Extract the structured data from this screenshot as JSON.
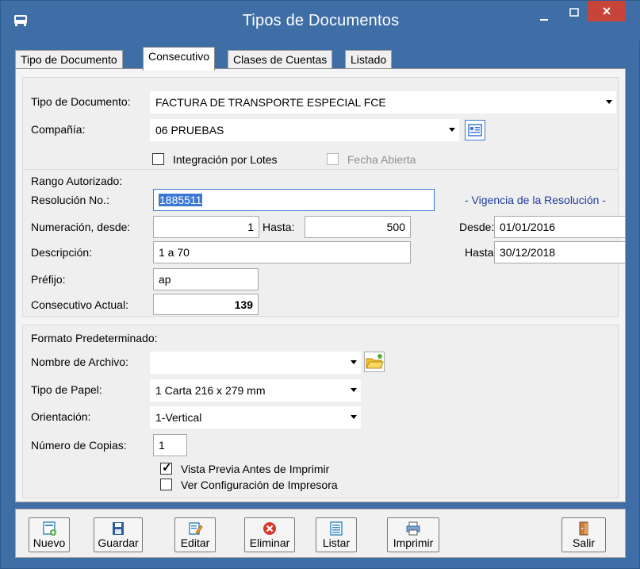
{
  "window": {
    "title": "Tipos de Documentos",
    "close_glyph": "×"
  },
  "tabs": [
    {
      "label": "Tipo de Documento"
    },
    {
      "label": "Consecutivo"
    },
    {
      "label": "Clases de Cuentas"
    },
    {
      "label": "Listado"
    }
  ],
  "form": {
    "tipo_documento": {
      "label": "Tipo de Documento:",
      "value": "FACTURA DE TRANSPORTE ESPECIAL FCE"
    },
    "compania": {
      "label": "Compañía:",
      "value": "06 PRUEBAS"
    },
    "integracion_lotes": {
      "label": "Integración por Lotes",
      "checked": false
    },
    "fecha_abierta": {
      "label": "Fecha Abierta",
      "checked": false,
      "enabled": false
    },
    "rango": {
      "title": "Rango Autorizado:",
      "resolucion_label": "Resolución No.:",
      "resolucion_value": "1885511",
      "vigencia_label": "- Vigencia de la Resolución -",
      "numeracion_label": "Numeración, desde:",
      "desde_num": "1",
      "hasta_label": "Hasta:",
      "hasta_num": "500",
      "fecha_desde_label": "Desde:",
      "fecha_desde": "01/01/2016",
      "fecha_hasta_label": "Hasta:",
      "fecha_hasta": "30/12/2018",
      "descripcion_label": "Descripción:",
      "descripcion": "1 a 70",
      "prefijo_label": "Préfijo:",
      "prefijo": "ap",
      "consecutivo_label": "Consecutivo Actual:",
      "consecutivo": "139"
    },
    "formato": {
      "title": "Formato Predeterminado:",
      "archivo_label": "Nombre de Archivo:",
      "archivo": "",
      "papel_label": "Tipo de Papel:",
      "papel": "1 Carta 216 x 279 mm",
      "orientacion_label": "Orientación:",
      "orientacion": "1-Vertical",
      "copias_label": "Número de Copias:",
      "copias": "1",
      "vista_previa": {
        "label": "Vista Previa Antes de Imprimir",
        "checked": true
      },
      "ver_config": {
        "label": "Ver Configuración de Impresora",
        "checked": false
      }
    }
  },
  "toolbar": {
    "nuevo": "Nuevo",
    "guardar": "Guardar",
    "editar": "Editar",
    "eliminar": "Eliminar",
    "listar": "Listar",
    "imprimir": "Imprimir",
    "salir": "Salir"
  },
  "colors": {
    "titlebar": "#3f6ea7",
    "close": "#c7443b",
    "selection": "#3b78d4"
  }
}
